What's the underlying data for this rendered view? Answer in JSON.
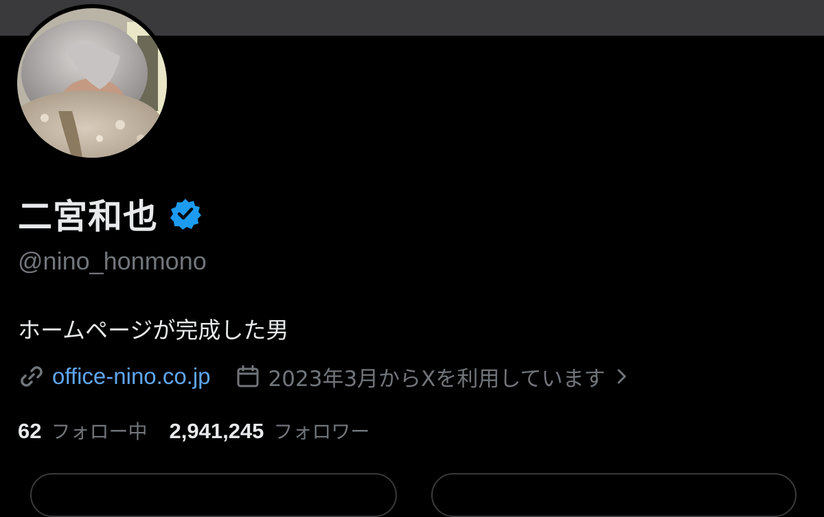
{
  "profile": {
    "display_name": "二宮和也",
    "handle": "@nino_honmono",
    "bio": "ホームページが完成した男",
    "website": "office-nino.co.jp",
    "joined": "2023年3月からXを利用しています",
    "verified": true
  },
  "stats": {
    "following_count": "62",
    "following_label": "フォロー中",
    "followers_count": "2,941,245",
    "followers_label": "フォロワー"
  },
  "icons": {
    "verified": "verified-badge-icon",
    "link": "link-icon",
    "calendar": "calendar-icon",
    "chevron": "chevron-right-icon"
  },
  "colors": {
    "background": "#000000",
    "banner": "#3a3a3c",
    "text_primary": "#e7e9ea",
    "text_secondary": "#71767b",
    "link": "#5fa6f1",
    "verified": "#1d9bf0"
  }
}
